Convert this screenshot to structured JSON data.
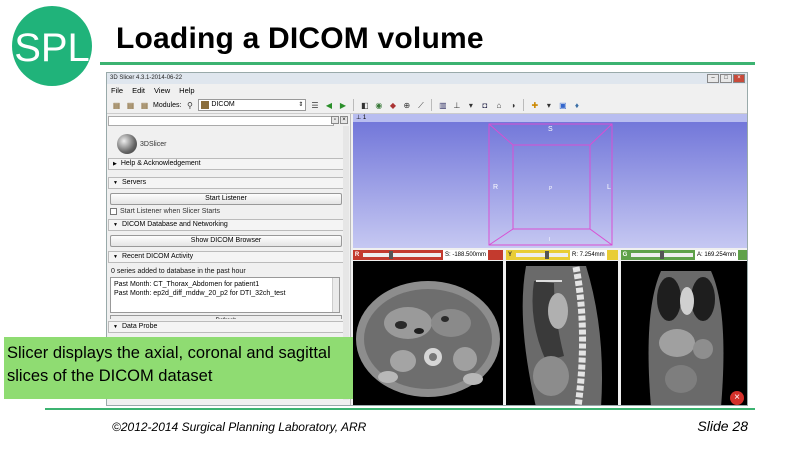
{
  "slide": {
    "logo_text": "SPL",
    "title": "Loading a DICOM volume",
    "caption": "Slicer displays the axial, coronal and sagittal slices of the DICOM dataset",
    "footer": "©2012-2014 Surgical Planning Laboratory, ARR",
    "slide_number": "Slide 28",
    "colors": {
      "accent": "#3cb371",
      "caption_bg": "#8fdc72"
    }
  },
  "app": {
    "window_title": "3D Slicer 4.3.1-2014-06-22",
    "menu": [
      "File",
      "Edit",
      "View",
      "Help"
    ],
    "modules_label": "Modules:",
    "module_selected": "DICOM"
  },
  "panel": {
    "logo_label": "3DSlicer",
    "help_section": "Help & Acknowledgement",
    "servers_section": "Servers",
    "start_listener_button": "Start Listener",
    "start_listener_checkbox": "Start Listener when Slicer Starts",
    "db_section": "DICOM Database and Networking",
    "show_browser_button": "Show DICOM Browser",
    "recent_section": "Recent DICOM Activity",
    "series_added": "0 series added to database in the past hour",
    "activity_items": [
      "Past Month: CT_Thorax_Abdomen for patient1",
      "Past Month: ep2d_diff_mddw_20_p2 for DTI_32ch_test"
    ],
    "refresh_button": "Refresh",
    "data_probe_section": "Data Probe"
  },
  "views": {
    "view3d_index": "1",
    "orientation": {
      "top": "S",
      "left": "R",
      "right": "L",
      "center": "P",
      "bottom": "I"
    },
    "red": {
      "letter": "R",
      "value": "S: -188.500mm",
      "color": "#c33a2e",
      "slider": 0.35
    },
    "yellow": {
      "letter": "Y",
      "value": "R: 7.254mm",
      "color": "#e9cd35",
      "slider": 0.6
    },
    "green": {
      "letter": "G",
      "value": "A: 169.254mm",
      "color": "#5fa14a",
      "slider": 0.5
    }
  }
}
